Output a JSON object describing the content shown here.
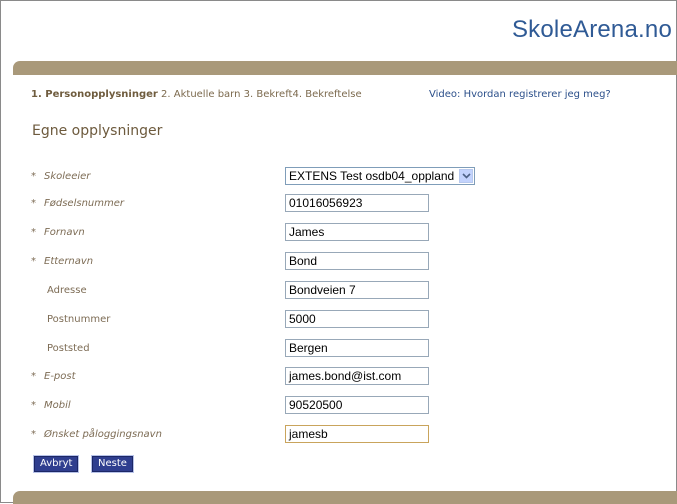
{
  "logo": "SkoleArena.no",
  "steps": {
    "step1": "1. Personopplysninger",
    "step2": "2. Aktuelle barn",
    "step3": "3. Bekreft",
    "step4": "4. Bekreftelse"
  },
  "video_link": "Video: Hvordan registrerer jeg meg?",
  "section_title": "Egne opplysninger",
  "fields": {
    "skoleeier": {
      "label": "Skoleeier",
      "value": "EXTENS Test osdb04_oppland"
    },
    "fodselsnummer": {
      "label": "Fødselsnummer",
      "value": "01016056923"
    },
    "fornavn": {
      "label": "Fornavn",
      "value": "James"
    },
    "etternavn": {
      "label": "Etternavn",
      "value": "Bond"
    },
    "adresse": {
      "label": "Adresse",
      "value": "Bondveien 7"
    },
    "postnummer": {
      "label": "Postnummer",
      "value": "5000"
    },
    "poststed": {
      "label": "Poststed",
      "value": "Bergen"
    },
    "epost": {
      "label": "E-post",
      "value": "james.bond@ist.com"
    },
    "mobil": {
      "label": "Mobil",
      "value": "90520500"
    },
    "brukernavn": {
      "label": "Ønsket påloggingsnavn",
      "value": "jamesb"
    }
  },
  "required_marker": "*",
  "buttons": {
    "cancel": "Avbryt",
    "next": "Neste"
  },
  "colors": {
    "brand_bar": "#a9997a",
    "button": "#2f3e8f",
    "logo": "#2f5a95"
  }
}
